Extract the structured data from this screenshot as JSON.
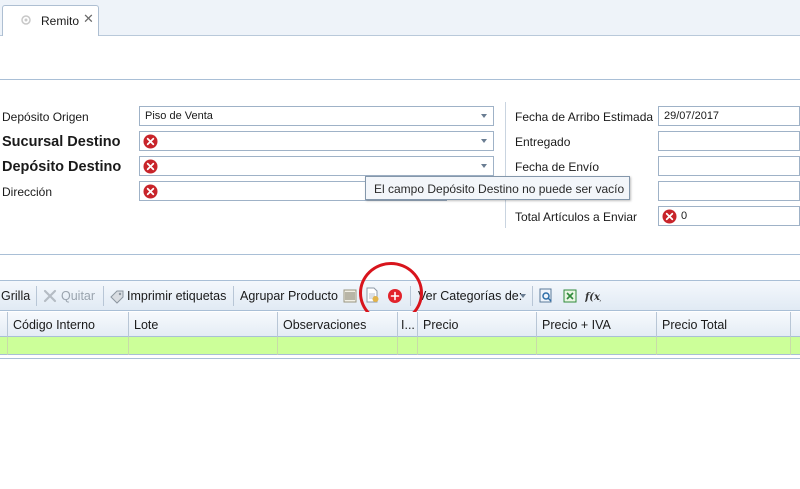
{
  "tab": {
    "label": "Remito",
    "close": "✕"
  },
  "form": {
    "deposito_origen": {
      "label": "Depósito Origen",
      "value": "Piso de Venta"
    },
    "sucursal_destino": {
      "label": "Sucursal Destino",
      "value": ""
    },
    "deposito_destino": {
      "label": "Depósito Destino",
      "value": ""
    },
    "direccion": {
      "label": "Dirección",
      "value": ""
    },
    "fecha_arribo": {
      "label": "Fecha de Arribo Estimada",
      "value": "29/07/2017"
    },
    "entregado": {
      "label": "Entregado",
      "value": ""
    },
    "fecha_envio": {
      "label": "Fecha de Envío",
      "value": ""
    },
    "total_articulos": {
      "label": "Total Artículos a Enviar",
      "value": "0"
    }
  },
  "tooltip": {
    "text": "El campo Depósito Destino no puede ser vacío"
  },
  "toolbar": {
    "grilla": "Grilla",
    "quitar": "Quitar",
    "imprimir": "Imprimir etiquetas",
    "agrupar": "Agrupar Producto",
    "ver_categorias": "Ver Categorías de:"
  },
  "grid": {
    "columns": [
      "Código Interno",
      "Lote",
      "Observaciones",
      "I...",
      "Precio",
      "Precio + IVA",
      "Precio Total"
    ]
  },
  "colors": {
    "error_red": "#d8141c",
    "row_highlight": "#ccff99",
    "border_blue": "#a9bfd6"
  }
}
